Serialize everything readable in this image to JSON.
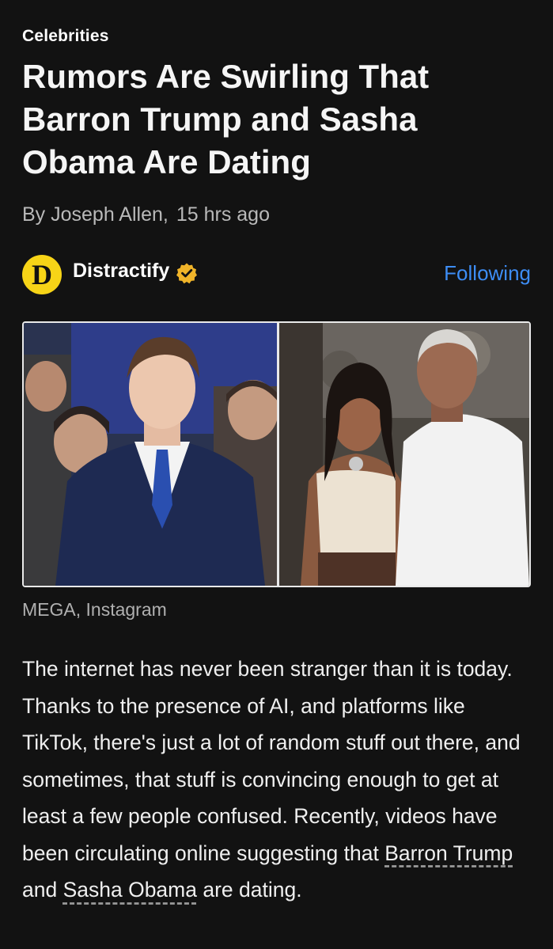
{
  "article": {
    "category": "Celebrities",
    "headline": "Rumors Are Swirling That Barron Trump and Sasha Obama Are Dating",
    "byline": {
      "author": "By Joseph Allen,",
      "time": "15 hrs ago"
    },
    "publisher": {
      "logo_letter": "D",
      "name": "Distractify",
      "follow_label": "Following",
      "logo_color": "#f7d417",
      "follow_color": "#3d8df5"
    },
    "image_caption": "MEGA, Instagram",
    "body": {
      "part1": "The internet has never been stranger than it is today. Thanks to the presence of AI, and platforms like TikTok, there's just a lot of random stuff out there, and sometimes, that stuff is convincing enough to get at least a few people confused. Recently, videos have been circulating online suggesting that ",
      "link1": "Barron Trump",
      "part2": " and ",
      "link2": "Sasha Obama",
      "part3": " are dating."
    }
  }
}
